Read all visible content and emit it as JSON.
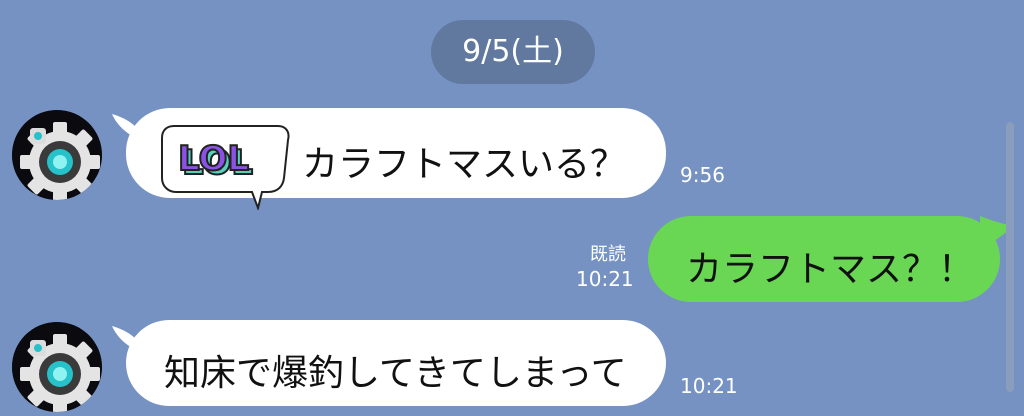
{
  "date_pill": {
    "label": "9/5(土)"
  },
  "messages": [
    {
      "side": "incoming",
      "text": "カラフトマスいる？",
      "time": "9:56",
      "sticker_text": "LOL"
    },
    {
      "side": "outgoing",
      "text": "カラフトマス？！",
      "read_label": "既読",
      "time": "10:21"
    },
    {
      "side": "incoming",
      "text": "知床で爆釣してきてしまって",
      "time": "10:21"
    }
  ],
  "icons": {
    "avatar": "gear-avatar-icon",
    "sticker": "lol-sticker-icon"
  },
  "colors": {
    "background": "#7592c3",
    "date_pill": "#61799f",
    "incoming_bubble": "#ffffff",
    "outgoing_bubble": "#6ad754",
    "text": "#111111",
    "sticker_purple": "#8a53e5",
    "sticker_teal": "#59d0bf"
  }
}
